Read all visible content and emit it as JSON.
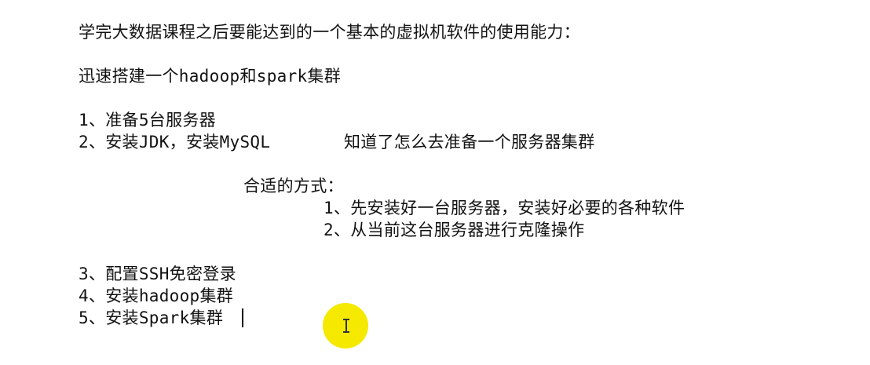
{
  "document": {
    "title_line": "学完大数据课程之后要能达到的一个基本的虚拟机软件的使用能力：",
    "goal_line": "迅速搭建一个hadoop和spark集群",
    "steps": [
      {
        "text": "1、准备5台服务器"
      },
      {
        "text": "2、安装JDK，安装MySQL"
      },
      {
        "text": "3、配置SSH免密登录"
      },
      {
        "text": "4、安装hadoop集群"
      },
      {
        "text": "5、安装Spark集群"
      }
    ],
    "side_note": "知道了怎么去准备一个服务器集群",
    "method_heading": "合适的方式：",
    "methods": [
      {
        "text": "1、先安装好一台服务器，安装好必要的各种软件"
      },
      {
        "text": "2、从当前这台服务器进行克隆操作"
      }
    ]
  },
  "overlay": {
    "highlight_color": "#f5e900",
    "pointer_icon": "text-cursor-icon"
  }
}
